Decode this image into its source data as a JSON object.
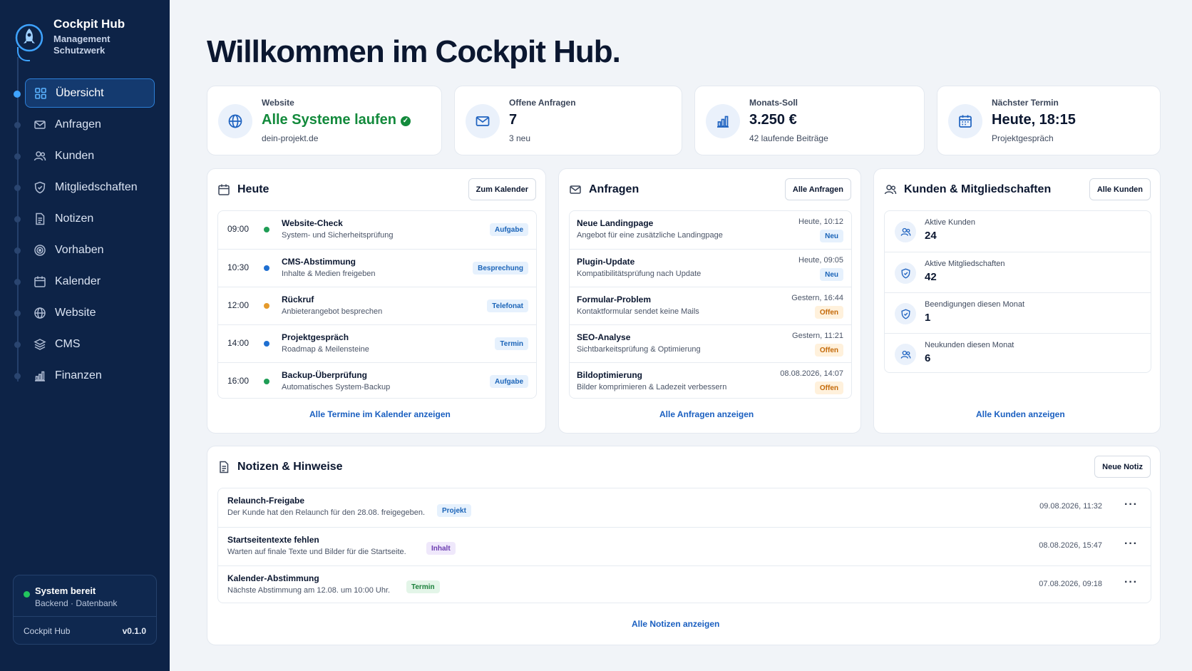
{
  "brand": {
    "title": "Cockpit Hub",
    "subtitle": "Management Schutzwerk"
  },
  "nav": [
    {
      "label": "Übersicht",
      "icon": "grid-icon",
      "active": true
    },
    {
      "label": "Anfragen",
      "icon": "mail-icon"
    },
    {
      "label": "Kunden",
      "icon": "users-icon"
    },
    {
      "label": "Mitgliedschaften",
      "icon": "shield-icon"
    },
    {
      "label": "Notizen",
      "icon": "document-icon"
    },
    {
      "label": "Vorhaben",
      "icon": "target-icon"
    },
    {
      "label": "Kalender",
      "icon": "calendar-icon"
    },
    {
      "label": "Website",
      "icon": "globe-icon"
    },
    {
      "label": "CMS",
      "icon": "layers-icon"
    },
    {
      "label": "Finanzen",
      "icon": "bar-chart-icon"
    }
  ],
  "system": {
    "title": "System bereit",
    "subtitle": "Backend · Datenbank",
    "app": "Cockpit Hub",
    "version": "v0.1.0"
  },
  "page_title": "Willkommen im Cockpit Hub.",
  "stats": [
    {
      "label": "Website",
      "value": "Alle Systeme laufen",
      "sub": "dein-projekt.de",
      "icon": "globe-icon"
    },
    {
      "label": "Offene Anfragen",
      "value": "7",
      "sub": "3 neu",
      "icon": "mail-icon"
    },
    {
      "label": "Monats-Soll",
      "value": "3.250 €",
      "sub": "42 laufende Beiträge",
      "icon": "bar-chart-icon"
    },
    {
      "label": "Nächster Termin",
      "value": "Heute, 18:15",
      "sub": "Projektgespräch",
      "icon": "calendar-icon"
    }
  ],
  "today": {
    "title": "Heute",
    "button": "Zum Kalender",
    "link": "Alle Termine im Kalender anzeigen",
    "items": [
      {
        "time": "09:00",
        "title": "Website-Check",
        "sub": "System- und Sicherheitsprüfung",
        "tag": "Aufgabe",
        "dot": "#1f9d55"
      },
      {
        "time": "10:30",
        "title": "CMS-Abstimmung",
        "sub": "Inhalte & Medien freigeben",
        "tag": "Besprechung",
        "dot": "#1f6fd1"
      },
      {
        "time": "12:00",
        "title": "Rückruf",
        "sub": "Anbieterangebot besprechen",
        "tag": "Telefonat",
        "dot": "#e59a2c"
      },
      {
        "time": "14:00",
        "title": "Projektgespräch",
        "sub": "Roadmap & Meilensteine",
        "tag": "Termin",
        "dot": "#1f6fd1"
      },
      {
        "time": "16:00",
        "title": "Backup-Überprüfung",
        "sub": "Automatisches System-Backup",
        "tag": "Aufgabe",
        "dot": "#1f9d55"
      }
    ]
  },
  "requests": {
    "title": "Anfragen",
    "button": "Alle Anfragen",
    "link": "Alle Anfragen anzeigen",
    "items": [
      {
        "title": "Neue Landingpage",
        "sub": "Angebot für eine zusätzliche Landingpage",
        "date": "Heute, 10:12",
        "tag": "Neu",
        "tag_style": "blue"
      },
      {
        "title": "Plugin-Update",
        "sub": "Kompatibilitätsprüfung nach Update",
        "date": "Heute, 09:05",
        "tag": "Neu",
        "tag_style": "blue"
      },
      {
        "title": "Formular-Problem",
        "sub": "Kontaktformular sendet keine Mails",
        "date": "Gestern, 16:44",
        "tag": "Offen",
        "tag_style": "orange"
      },
      {
        "title": "SEO-Analyse",
        "sub": "Sichtbarkeitsprüfung & Optimierung",
        "date": "Gestern, 11:21",
        "tag": "Offen",
        "tag_style": "orange"
      },
      {
        "title": "Bildoptimierung",
        "sub": "Bilder komprimieren & Ladezeit verbessern",
        "date": "08.08.2026, 14:07",
        "tag": "Offen",
        "tag_style": "orange"
      }
    ]
  },
  "customers": {
    "title": "Kunden & Mitgliedschaften",
    "button": "Alle Kunden",
    "link": "Alle Kunden anzeigen",
    "items": [
      {
        "label": "Aktive Kunden",
        "value": "24",
        "icon": "users-icon"
      },
      {
        "label": "Aktive Mitgliedschaften",
        "value": "42",
        "icon": "shield-icon"
      },
      {
        "label": "Beendigungen diesen Monat",
        "value": "1",
        "icon": "shield-icon"
      },
      {
        "label": "Neukunden diesen Monat",
        "value": "6",
        "icon": "users-icon"
      }
    ]
  },
  "notes": {
    "title": "Notizen & Hinweise",
    "button": "Neue Notiz",
    "link": "Alle Notizen anzeigen",
    "more": "···",
    "items": [
      {
        "title": "Relaunch-Freigabe",
        "sub": "Der Kunde hat den Relaunch für den 28.08. freigegeben.",
        "tag": "Projekt",
        "tag_style": "blue",
        "date": "09.08.2026, 11:32"
      },
      {
        "title": "Startseitentexte fehlen",
        "sub": "Warten auf finale Texte und Bilder für die Startseite.",
        "tag": "Inhalt",
        "tag_style": "purple",
        "date": "08.08.2026, 15:47"
      },
      {
        "title": "Kalender-Abstimmung",
        "sub": "Nächste Abstimmung am 12.08. um 10:00 Uhr.",
        "tag": "Termin",
        "tag_style": "green",
        "date": "07.08.2026, 09:18"
      }
    ]
  },
  "colors": {
    "sidebar": "#0d2347",
    "accent": "#3ea3ff",
    "success": "#138a3c",
    "link": "#1a5fc0"
  }
}
